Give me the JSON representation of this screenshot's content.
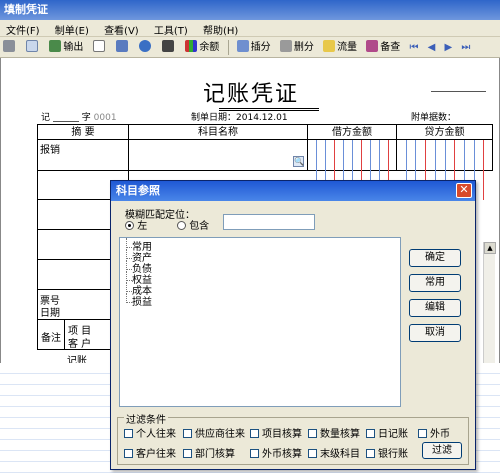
{
  "window": {
    "title": "填制凭证"
  },
  "menu": [
    "文件(F)",
    "制单(E)",
    "查看(V)",
    "工具(T)",
    "帮助(H)"
  ],
  "toolbar": {
    "output": "输出",
    "balance": "余额",
    "insert": "插分",
    "delete": "删分",
    "flow": "流量",
    "memo": "备查"
  },
  "voucher": {
    "title": "记账凭证",
    "type_label": "记",
    "number_label": "字",
    "number_value": "0001",
    "date_label": "制单日期：",
    "date_value": "2014.12.01",
    "attachments_label": "附单据数："
  },
  "table": {
    "headers": {
      "summary": "摘 要",
      "account": "科目名称",
      "debit": "借方金额",
      "credit": "贷方金额"
    },
    "first_summary": "报销",
    "ticket_label": "票号",
    "date_label": "日期",
    "remark_label": "备注",
    "project_label": "项 目",
    "customer_label": "客 户",
    "bookkeeper_label": "记账"
  },
  "dialog": {
    "title": "科目参照",
    "close": "✕",
    "fuzzy": {
      "label": "模糊匹配定位：",
      "left": "左",
      "contains": "包含",
      "value": ""
    },
    "tree": [
      "常用",
      "资产",
      "负债",
      "权益",
      "成本",
      "损益"
    ],
    "buttons": {
      "ok": "确定",
      "common": "常用",
      "edit": "编辑",
      "cancel": "取消"
    },
    "filter": {
      "label": "过滤条件",
      "row1": [
        "个人往来",
        "供应商往来",
        "项目核算",
        "数量核算",
        "日记账",
        "外币"
      ],
      "row2": [
        "客户往来",
        "部门核算",
        "外币核算",
        "末级科目",
        "银行账"
      ],
      "filter_button": "过滤"
    }
  },
  "colors": {
    "title_bar": "#2f66c9",
    "dialog_title": "#1f58d4",
    "close_button": "#d94a2a",
    "amount_red": "#e04040",
    "amount_blue": "#6a8fd8"
  }
}
